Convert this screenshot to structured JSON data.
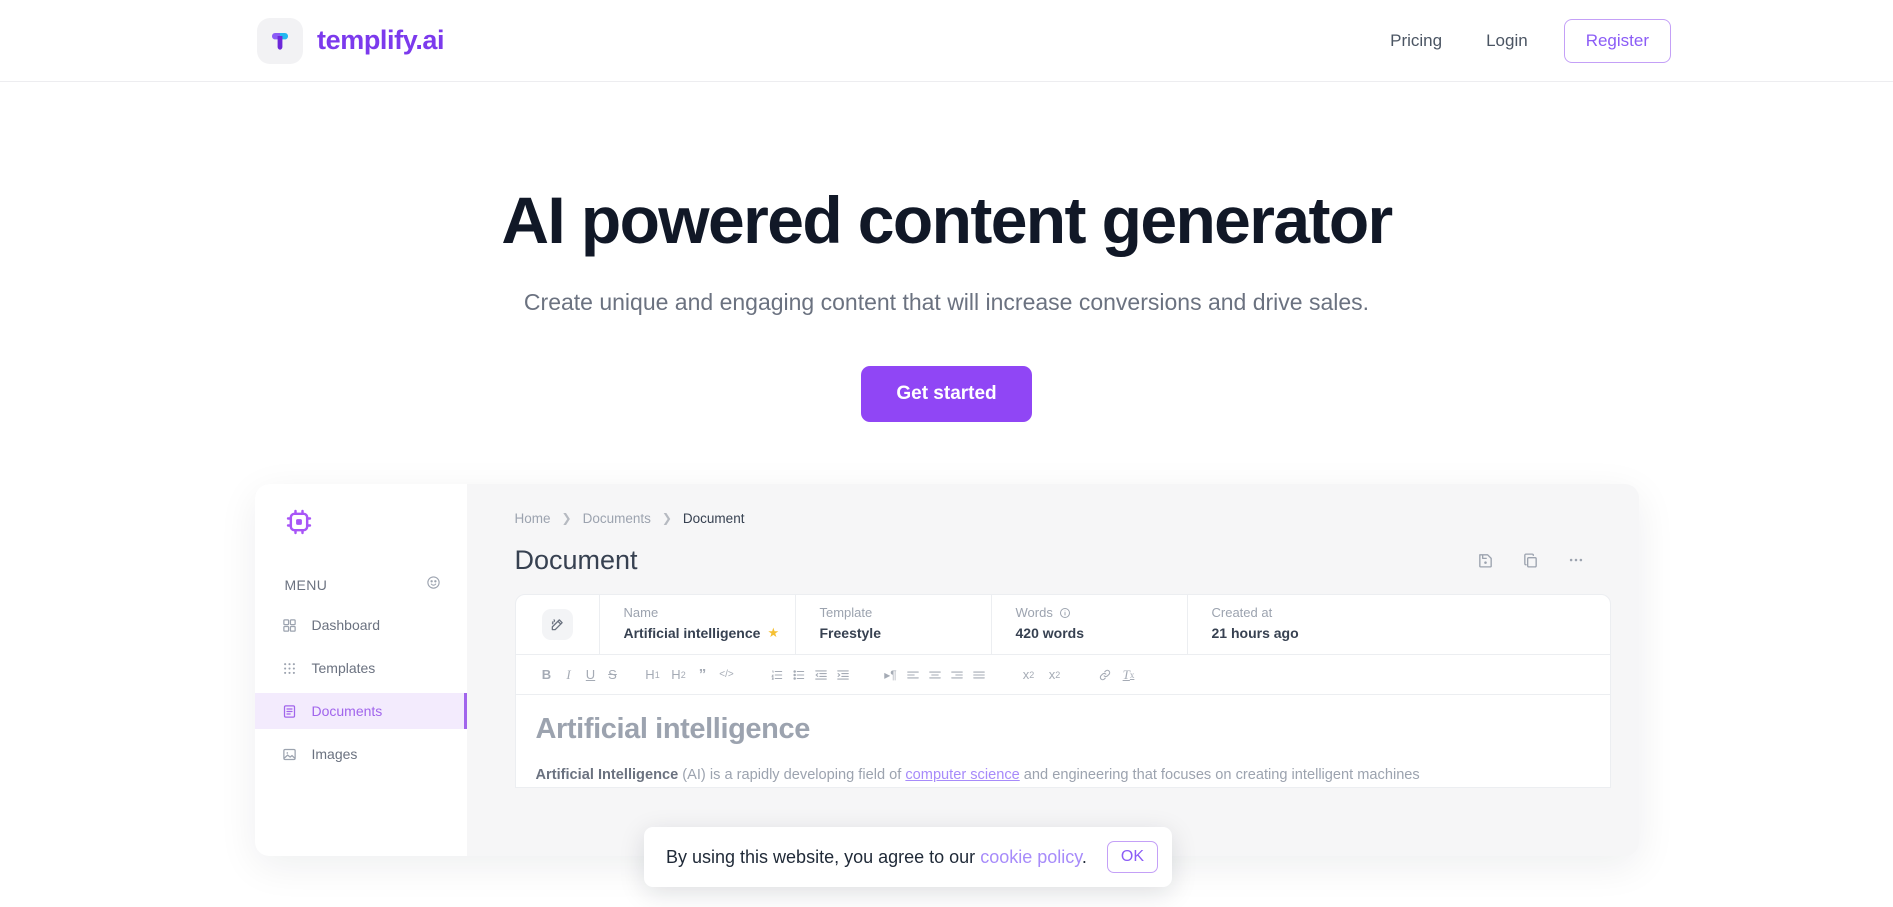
{
  "site": {
    "brand_name": "templify.ai",
    "brand_icon": "templify-logo-icon"
  },
  "nav": {
    "links": [
      {
        "label": "Pricing",
        "name": "nav-link-pricing"
      },
      {
        "label": "Login",
        "name": "nav-link-login"
      }
    ],
    "register_label": "Register"
  },
  "hero": {
    "title": "AI powered content generator",
    "subtitle": "Create unique and engaging content that will increase conversions and drive sales.",
    "cta_label": "Get started"
  },
  "app_preview": {
    "sidebar": {
      "logo_icon": "cpu-chip-icon",
      "menu_label": "MENU",
      "menu_action_icon": "face-smile-icon",
      "items": [
        {
          "label": "Dashboard",
          "icon": "grid-squares-icon",
          "active": false
        },
        {
          "label": "Templates",
          "icon": "dots-grid-icon",
          "active": false
        },
        {
          "label": "Documents",
          "icon": "document-lines-icon",
          "active": true
        },
        {
          "label": "Images",
          "icon": "image-icon",
          "active": false
        }
      ]
    },
    "breadcrumb": [
      {
        "label": "Home",
        "current": false
      },
      {
        "label": "Documents",
        "current": false
      },
      {
        "label": "Document",
        "current": true
      }
    ],
    "page_title": "Document",
    "actions": [
      {
        "icon": "save-file-icon",
        "name": "save-document-button"
      },
      {
        "icon": "copy-icon",
        "name": "duplicate-document-button"
      },
      {
        "icon": "ellipsis-icon",
        "name": "more-options-button"
      }
    ],
    "meta": {
      "wand_icon": "magic-wand-icon",
      "fields": [
        {
          "label": "Name",
          "value": "Artificial intelligence",
          "starred": true
        },
        {
          "label": "Template",
          "value": "Freestyle",
          "starred": false
        },
        {
          "label": "Words",
          "value": "420 words",
          "starred": false,
          "info": true
        },
        {
          "label": "Created at",
          "value": "21 hours ago",
          "starred": false
        }
      ]
    },
    "toolbar": [
      {
        "icon": "bold-icon",
        "glyph": "B"
      },
      {
        "icon": "italic-icon",
        "glyph": "I"
      },
      {
        "icon": "underline-icon",
        "glyph": "U"
      },
      {
        "icon": "strikethrough-icon",
        "glyph": "S"
      },
      {
        "icon": "heading-1-icon",
        "glyph": "H1"
      },
      {
        "icon": "heading-2-icon",
        "glyph": "H2"
      },
      {
        "icon": "blockquote-icon",
        "glyph": "”"
      },
      {
        "icon": "code-block-icon",
        "glyph": "</>"
      },
      {
        "icon": "ordered-list-icon",
        "glyph": ""
      },
      {
        "icon": "bullet-list-icon",
        "glyph": ""
      },
      {
        "icon": "outdent-icon",
        "glyph": ""
      },
      {
        "icon": "indent-icon",
        "glyph": ""
      },
      {
        "icon": "text-direction-icon",
        "glyph": "¶"
      },
      {
        "icon": "align-left-icon",
        "glyph": ""
      },
      {
        "icon": "align-center-icon",
        "glyph": ""
      },
      {
        "icon": "align-right-icon",
        "glyph": ""
      },
      {
        "icon": "align-justify-icon",
        "glyph": ""
      },
      {
        "icon": "subscript-icon",
        "glyph": "x2"
      },
      {
        "icon": "superscript-icon",
        "glyph": "x2"
      },
      {
        "icon": "link-icon",
        "glyph": ""
      },
      {
        "icon": "clear-format-icon",
        "glyph": "Tx"
      }
    ],
    "document": {
      "heading": "Artificial intelligence",
      "paragraph_lead": "Artificial Intelligence",
      "paragraph_mid": " (AI) is a rapidly developing field of ",
      "paragraph_link": "computer science",
      "paragraph_tail": " and engineering that focuses on creating intelligent machines"
    }
  },
  "cookie_banner": {
    "message_before": "By using this website, you agree to our ",
    "link_label": "cookie policy",
    "message_after": ".",
    "ok_label": "OK"
  },
  "colors": {
    "brand_purple": "#7c3aed",
    "cta_purple": "#9046f5",
    "accent_light": "#a78bfa",
    "active_bg": "#f3ebfd"
  }
}
